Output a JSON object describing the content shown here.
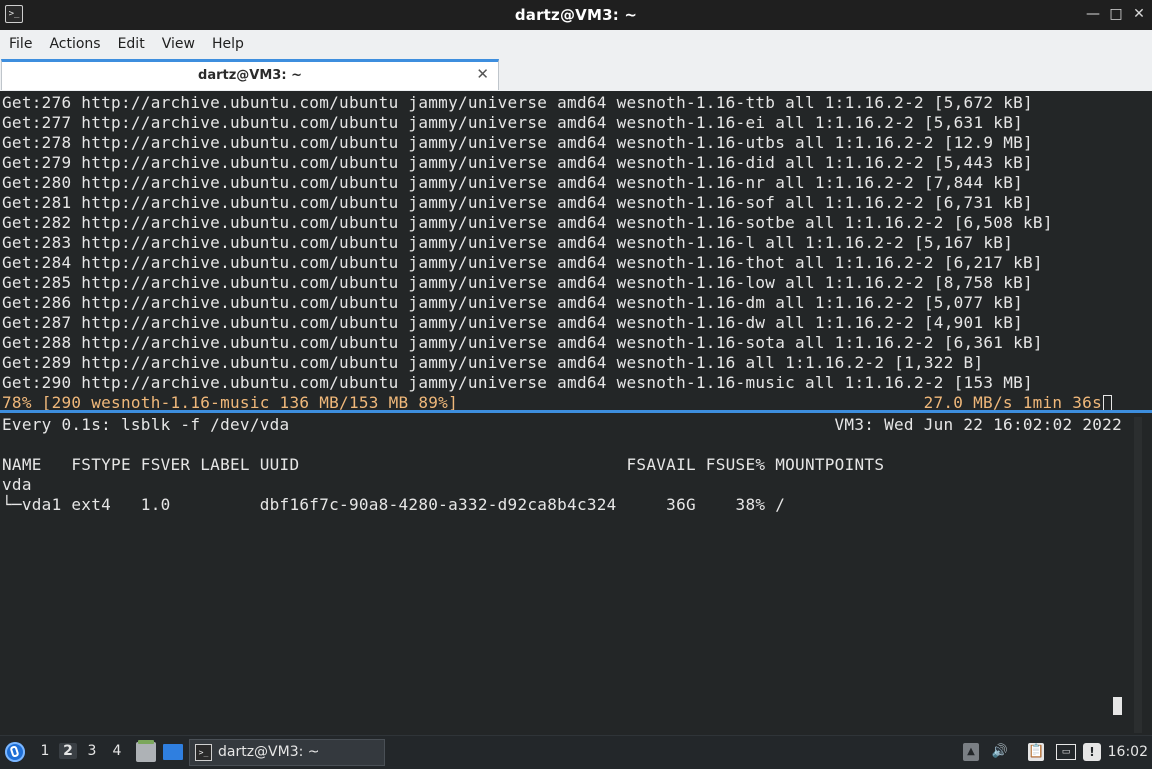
{
  "window": {
    "title": "dartz@VM3: ~",
    "app_icon_glyph": ">_",
    "minimize_glyph": "—",
    "maximize_glyph": "□",
    "close_glyph": "✕"
  },
  "menu": {
    "items": [
      "File",
      "Actions",
      "Edit",
      "View",
      "Help"
    ]
  },
  "tab": {
    "label": "dartz@VM3: ~",
    "close_glyph": "✕"
  },
  "terminal_top": {
    "lines": [
      "Get:276 http://archive.ubuntu.com/ubuntu jammy/universe amd64 wesnoth-1.16-ttb all 1:1.16.2-2 [5,672 kB]",
      "Get:277 http://archive.ubuntu.com/ubuntu jammy/universe amd64 wesnoth-1.16-ei all 1:1.16.2-2 [5,631 kB]",
      "Get:278 http://archive.ubuntu.com/ubuntu jammy/universe amd64 wesnoth-1.16-utbs all 1:1.16.2-2 [12.9 MB]",
      "Get:279 http://archive.ubuntu.com/ubuntu jammy/universe amd64 wesnoth-1.16-did all 1:1.16.2-2 [5,443 kB]",
      "Get:280 http://archive.ubuntu.com/ubuntu jammy/universe amd64 wesnoth-1.16-nr all 1:1.16.2-2 [7,844 kB]",
      "Get:281 http://archive.ubuntu.com/ubuntu jammy/universe amd64 wesnoth-1.16-sof all 1:1.16.2-2 [6,731 kB]",
      "Get:282 http://archive.ubuntu.com/ubuntu jammy/universe amd64 wesnoth-1.16-sotbe all 1:1.16.2-2 [6,508 kB]",
      "Get:283 http://archive.ubuntu.com/ubuntu jammy/universe amd64 wesnoth-1.16-l all 1:1.16.2-2 [5,167 kB]",
      "Get:284 http://archive.ubuntu.com/ubuntu jammy/universe amd64 wesnoth-1.16-thot all 1:1.16.2-2 [6,217 kB]",
      "Get:285 http://archive.ubuntu.com/ubuntu jammy/universe amd64 wesnoth-1.16-low all 1:1.16.2-2 [8,758 kB]",
      "Get:286 http://archive.ubuntu.com/ubuntu jammy/universe amd64 wesnoth-1.16-dm all 1:1.16.2-2 [5,077 kB]",
      "Get:287 http://archive.ubuntu.com/ubuntu jammy/universe amd64 wesnoth-1.16-dw all 1:1.16.2-2 [4,901 kB]",
      "Get:288 http://archive.ubuntu.com/ubuntu jammy/universe amd64 wesnoth-1.16-sota all 1:1.16.2-2 [6,361 kB]",
      "Get:289 http://archive.ubuntu.com/ubuntu jammy/universe amd64 wesnoth-1.16 all 1:1.16.2-2 [1,322 B]",
      "Get:290 http://archive.ubuntu.com/ubuntu jammy/universe amd64 wesnoth-1.16-music all 1:1.16.2-2 [153 MB]"
    ],
    "progress_left": "78% [290 wesnoth-1.16-music 136 MB/153 MB 89%]",
    "progress_right": "27.0 MB/s 1min 36s",
    "progress_color": "#f0b87a"
  },
  "terminal_bottom": {
    "watch_header": "Every 0.1s: lsblk -f /dev/vda",
    "watch_right": "VM3: Wed Jun 22 16:02:02 2022",
    "header": "NAME   FSTYPE FSVER LABEL UUID                                 FSAVAIL FSUSE% MOUNTPOINTS",
    "row1": "vda",
    "row2": "└─vda1 ext4   1.0         dbf16f7c-90a8-4280-a332-d92ca8b4c324     36G    38% /"
  },
  "taskbar": {
    "workspaces": [
      "1",
      "2",
      "3",
      "4"
    ],
    "active_workspace": "2",
    "task_label": "dartz@VM3: ~",
    "task_icon_glyph": ">_",
    "tray_up_glyph": "▲",
    "volume_glyph": "🔊",
    "clipboard_glyph": "📋",
    "network_glyph": "▭",
    "info_glyph": "!",
    "clock": "16:02"
  },
  "colors": {
    "accent": "#3d8ede",
    "terminal_bg": "#232627",
    "terminal_fg": "#e6e6e6",
    "taskbar_bg": "#23272a"
  }
}
